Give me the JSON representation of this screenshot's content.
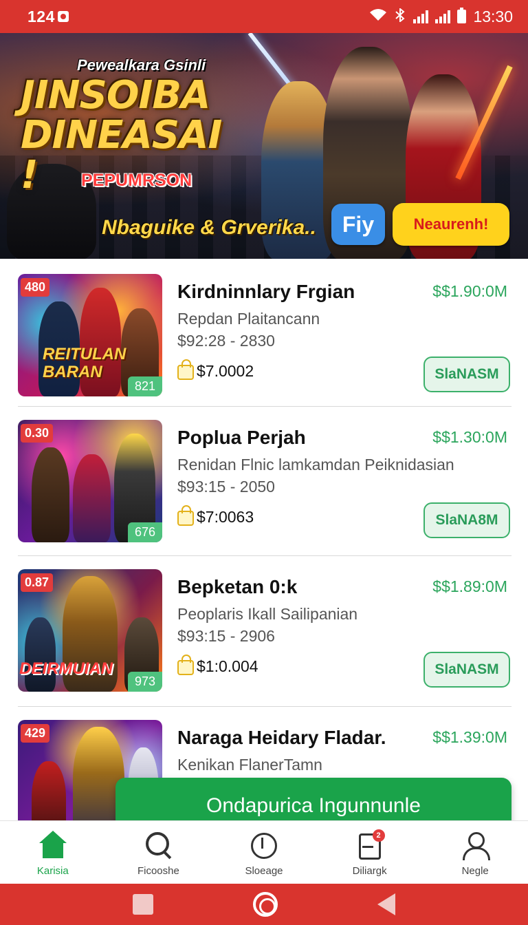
{
  "status_bar": {
    "time_left": "124",
    "time_right": "13:30"
  },
  "hero": {
    "subtitle": "Pewealkara Gsinli",
    "title": "JINSOIBA DINEASAI !",
    "tag": "PEPUMRSON",
    "caption": "Nbaguike & Grverika..",
    "play_label": "Fiy",
    "register_label": "Neaurenh!"
  },
  "items": [
    {
      "rank": "480",
      "count": "821",
      "overlay": "REITULAN BARAN",
      "title": "Kirdninnlary Frgian",
      "price": "$$1.90:0M",
      "subtitle": "Repdan Plaitancann",
      "range": "$92:28 - 2830",
      "amount": "$7.0002",
      "action": "SlaNASM"
    },
    {
      "rank": "0.30",
      "count": "676",
      "overlay": "",
      "title": "Poplua Perjah",
      "price": "$$1.30:0M",
      "subtitle": "Renidan Flnic lamkamdan Peiknidasian",
      "range": "$93:15 - 2050",
      "amount": "$7:0063",
      "action": "SlaNA8M"
    },
    {
      "rank": "0.87",
      "count": "973",
      "overlay": "DEIRMUIAN",
      "title": "Bepketan 0:k",
      "price": "$$1.89:0M",
      "subtitle": "Peoplaris Ikall Sailipanian",
      "range": "$93:15 - 2906",
      "amount": "$1:0.004",
      "action": "SlaNASM"
    },
    {
      "rank": "429",
      "count": "",
      "overlay": "",
      "title": "Naraga Heidary Fladar.",
      "price": "$$1.39:0M",
      "subtitle": "Kenikan FlanerTamn",
      "range": "",
      "amount": "",
      "action": ""
    }
  ],
  "cta": {
    "label": "Ondapurica Ingunnunle"
  },
  "nav": [
    {
      "label": "Karisia",
      "icon": "home-icon",
      "active": true
    },
    {
      "label": "Ficooshe",
      "icon": "search-icon"
    },
    {
      "label": "Sloeage",
      "icon": "clock-icon"
    },
    {
      "label": "Diliargk",
      "icon": "bag-icon",
      "badge": "2"
    },
    {
      "label": "Negle",
      "icon": "user-icon"
    }
  ],
  "colors": {
    "brand_red": "#d9342e",
    "accent_green": "#1aa34a",
    "price_green": "#2ba55c",
    "cta_yellow": "#ffd21c"
  }
}
